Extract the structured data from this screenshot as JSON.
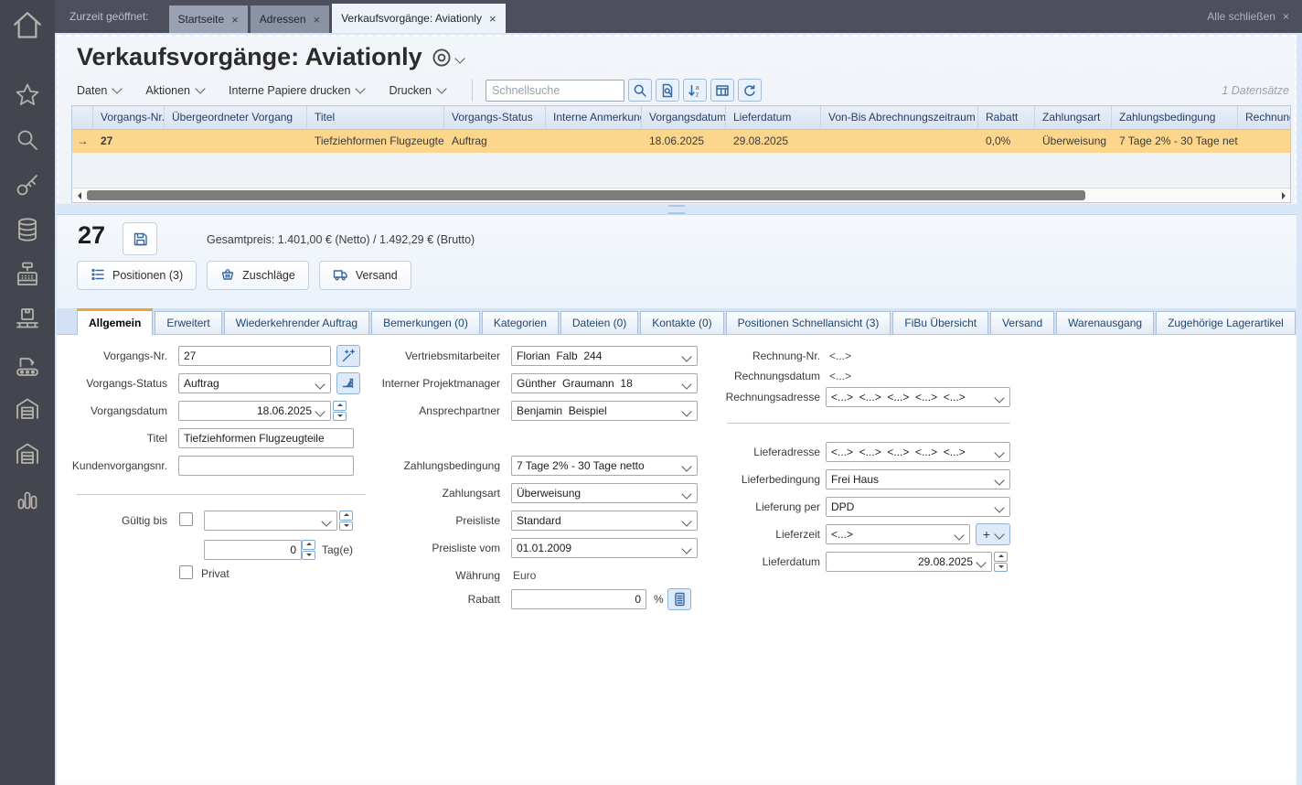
{
  "glyphs": {
    "close": "×",
    "row_arrow": "→",
    "plus": "+"
  },
  "sidebar": {
    "icons": [
      "home",
      "favorites-star",
      "search",
      "key",
      "database",
      "cash-register",
      "pallet-package",
      "production-conveyor",
      "warehouse-gate",
      "warehouse-gate-alt",
      "bar-chart"
    ]
  },
  "topbar": {
    "open_label": "Zurzeit geöffnet:",
    "tabs": [
      "Startseite",
      "Adressen",
      "Verkaufsvorgänge: Aviationly"
    ],
    "close_all": "Alle schließen"
  },
  "header": {
    "title": "Verkaufsvorgänge: Aviationly"
  },
  "toolbar": {
    "menus": [
      "Daten",
      "Aktionen",
      "Interne Papiere drucken",
      "Drucken"
    ],
    "search_placeholder": "Schnellsuche",
    "record_count": "1 Datensätze"
  },
  "list": {
    "columns": [
      "Vorgangs-Nr.",
      "Übergeordneter Vorgang",
      "Titel",
      "Vorgangs-Status",
      "Interne Anmerkung",
      "Vorgangsdatum",
      "Lieferdatum",
      "Von-Bis Abrechnungszeitraum",
      "Rabatt",
      "Zahlungsart",
      "Zahlungsbedingung",
      "Rechnungs"
    ],
    "row": [
      "27",
      "",
      "Tiefziehformen Flugzeugteile",
      "Auftrag",
      "",
      "18.06.2025",
      "29.08.2025",
      "",
      "0,0%",
      "Überweisung",
      "7 Tage 2% - 30 Tage netto",
      ""
    ]
  },
  "detail": {
    "record_number": "27",
    "total_line": "Gesamtpreis: 1.401,00 € (Netto) / 1.492,29 € (Brutto)",
    "buttons": {
      "positionen": "Positionen (3)",
      "zuschlaege": "Zuschläge",
      "versand": "Versand"
    }
  },
  "tabs": {
    "items": [
      "Allgemein",
      "Erweitert",
      "Wiederkehrender Auftrag",
      "Bemerkungen (0)",
      "Kategorien",
      "Dateien (0)",
      "Kontakte (0)",
      "Positionen Schnellansicht (3)",
      "FiBu Übersicht",
      "Versand",
      "Warenausgang",
      "Zugehörige Lagerartikel"
    ]
  },
  "form": {
    "vorgangs_nr": {
      "label": "Vorgangs-Nr.",
      "value": "27"
    },
    "vorgangs_status": {
      "label": "Vorgangs-Status",
      "value": "Auftrag"
    },
    "vorgangsdatum": {
      "label": "Vorgangsdatum",
      "value": "18.06.2025"
    },
    "titel": {
      "label": "Titel",
      "value": "Tiefziehformen Flugzeugteile"
    },
    "kundenvorgangsnr": {
      "label": "Kundenvorgangsnr.",
      "value": ""
    },
    "gueltig_bis": {
      "label": "Gültig bis",
      "value": ""
    },
    "gueltig_tage": {
      "value": "0",
      "suffix": "Tag(e)"
    },
    "privat": {
      "label": "Privat"
    },
    "vertriebsmitarbeiter": {
      "label": "Vertriebsmitarbeiter",
      "value": "Florian  Falb  244"
    },
    "projektmanager": {
      "label": "Interner Projektmanager",
      "value": "Günther  Graumann  18"
    },
    "ansprechpartner": {
      "label": "Ansprechpartner",
      "value": "Benjamin  Beispiel"
    },
    "zahlungsbedingung": {
      "label": "Zahlungsbedingung",
      "value": "7 Tage 2% - 30 Tage netto"
    },
    "zahlungsart": {
      "label": "Zahlungsart",
      "value": "Überweisung"
    },
    "preisliste": {
      "label": "Preisliste",
      "value": "Standard"
    },
    "preisliste_vom": {
      "label": "Preisliste vom",
      "value": "01.01.2009"
    },
    "waehrung": {
      "label": "Währung",
      "value": "Euro"
    },
    "rabatt": {
      "label": "Rabatt",
      "value": "0",
      "suffix": "%"
    },
    "rechnung_nr": {
      "label": "Rechnung-Nr.",
      "value": "<...>"
    },
    "rechnungsdatum": {
      "label": "Rechnungsdatum",
      "value": "<...>"
    },
    "rechnungsadresse": {
      "label": "Rechnungsadresse",
      "value": "<...>  <...>  <...>  <...>  <...>"
    },
    "lieferadresse": {
      "label": "Lieferadresse",
      "value": "<...>  <...>  <...>  <...>  <...>"
    },
    "lieferbedingung": {
      "label": "Lieferbedingung",
      "value": "Frei Haus"
    },
    "lieferung_per": {
      "label": "Lieferung per",
      "value": "DPD"
    },
    "lieferzeit": {
      "label": "Lieferzeit",
      "value": "<...>"
    },
    "lieferdatum": {
      "label": "Lieferdatum",
      "value": "29.08.2025"
    }
  }
}
